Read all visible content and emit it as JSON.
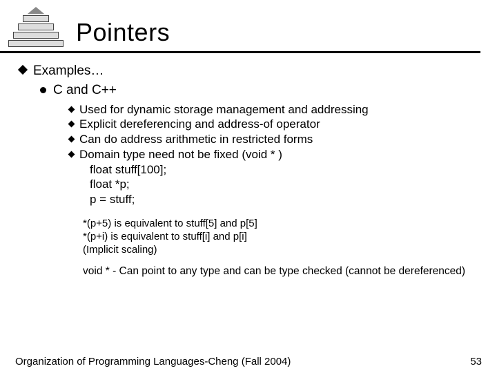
{
  "title": "Pointers",
  "bullets": {
    "l1": "Examples…",
    "l2": "C and C++",
    "l3a": "Used for dynamic storage management and addressing",
    "l3b": "Explicit dereferencing and address-of operator",
    "l3c": "Can do address arithmetic in restricted forms",
    "l3d": "Domain type need not be fixed (void * )"
  },
  "code": {
    "c1": "float stuff[100];",
    "c2": "float *p;",
    "c3": "p = stuff;"
  },
  "notes": {
    "n1": "*(p+5) is equivalent to stuff[5] and  p[5]",
    "n2": "*(p+i) is equivalent to stuff[i] and  p[i]",
    "n3": "(Implicit scaling)"
  },
  "voidnote": "void * - Can point to any type and can be type checked (cannot be dereferenced)",
  "footer": {
    "left": "Organization of Programming Languages-Cheng (Fall 2004)",
    "right": "53"
  }
}
